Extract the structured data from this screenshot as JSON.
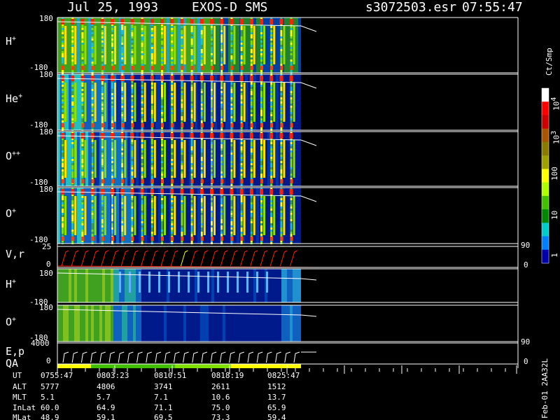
{
  "header": {
    "date": "Jul 25, 1993",
    "mission": "EXOS-D SMS",
    "file": "s3072503.esr",
    "time": "07:55:47"
  },
  "panels": [
    {
      "label": "H",
      "sup": "+",
      "top_tick": "180",
      "bot_tick": "-180"
    },
    {
      "label": "He",
      "sup": "+",
      "top_tick": "180",
      "bot_tick": "-180"
    },
    {
      "label": "O",
      "sup": "++",
      "top_tick": "180",
      "bot_tick": "-180"
    },
    {
      "label": "O",
      "sup": "+",
      "top_tick": "180",
      "bot_tick": "-180"
    }
  ],
  "vr_panel": {
    "label": "V,r",
    "top_tick": "25",
    "bot_tick": "0",
    "right_top": "90",
    "right_bot": "0"
  },
  "lower_panels": [
    {
      "label": "H",
      "sup": "+",
      "top_tick": "180",
      "bot_tick": "-180"
    },
    {
      "label": "O",
      "sup": "+",
      "top_tick": "180",
      "bot_tick": "-180"
    }
  ],
  "ep_panel": {
    "label": "E,p",
    "label2": "QA",
    "top_tick": "4000",
    "bot_tick": "0",
    "right_top": "90",
    "right_bot": "0"
  },
  "colorbar": {
    "unit": "Ct/Smp",
    "ticks": [
      {
        "label": "10",
        "sup": "4"
      },
      {
        "label": "10",
        "sup": "3"
      },
      {
        "label": "100",
        "sup": ""
      },
      {
        "label": "10",
        "sup": ""
      },
      {
        "label": "1",
        "sup": ""
      }
    ],
    "colors": [
      "#ffffff",
      "#ff0000",
      "#cc0000",
      "#aa5500",
      "#8a7a00",
      "#a0a000",
      "#ffff00",
      "#b0ff00",
      "#40c000",
      "#008800",
      "#00cccc",
      "#0080ff",
      "#0000aa"
    ]
  },
  "table": {
    "rows": [
      {
        "name": "UT",
        "values": [
          "0755:47",
          "0803:23",
          "0810:51",
          "0818:19",
          "0825:47"
        ]
      },
      {
        "name": "ALT",
        "values": [
          "5777",
          "4806",
          "3741",
          "2611",
          "1512"
        ]
      },
      {
        "name": "MLT",
        "values": [
          "5.1",
          "5.7",
          "7.1",
          "10.6",
          "13.7"
        ]
      },
      {
        "name": "InLat",
        "values": [
          "60.0",
          "64.9",
          "71.1",
          "75.0",
          "65.9"
        ]
      },
      {
        "name": "MLat",
        "values": [
          "48.9",
          "59.1",
          "69.5",
          "73.3",
          "59.4"
        ]
      }
    ]
  },
  "side_note": "Feb-01 2AA32L"
}
